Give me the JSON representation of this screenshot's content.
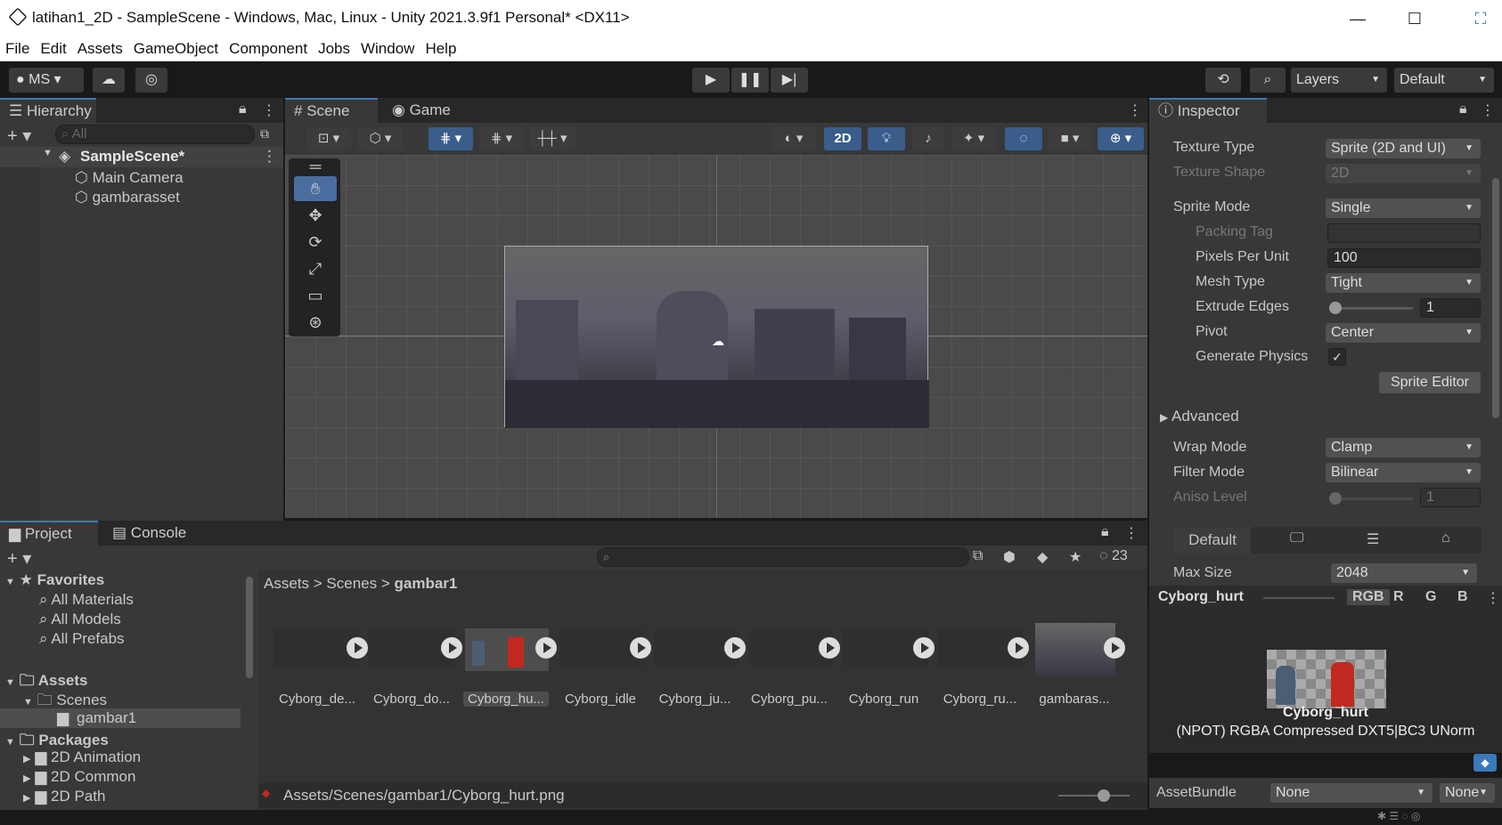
{
  "window": {
    "title": "latihan1_2D - SampleScene - Windows, Mac, Linux - Unity 2021.3.9f1 Personal* <DX11>",
    "minimize": "—",
    "maximize": "☐"
  },
  "menu": [
    "File",
    "Edit",
    "Assets",
    "GameObject",
    "Component",
    "Jobs",
    "Window",
    "Help"
  ],
  "toolbar": {
    "account": "MS",
    "layers": "Layers",
    "layout": "Default"
  },
  "hierarchy": {
    "tab": "Hierarchy",
    "search_placeholder": "All",
    "scene": "SampleScene*",
    "items": [
      "Main Camera",
      "gambarasset"
    ]
  },
  "scene_view": {
    "tabs": [
      "Scene",
      "Game"
    ],
    "mode_2d": "2D"
  },
  "inspector": {
    "tab": "Inspector",
    "rows": [
      {
        "label": "Texture Type",
        "value": "Sprite (2D and UI)"
      },
      {
        "label": "Texture Shape",
        "value": "2D"
      },
      {
        "label": "Sprite Mode",
        "value": "Single"
      },
      {
        "label": "Packing Tag",
        "value": ""
      },
      {
        "label": "Pixels Per Unit",
        "value": "100"
      },
      {
        "label": "Mesh Type",
        "value": "Tight"
      },
      {
        "label": "Extrude Edges",
        "value": "1"
      },
      {
        "label": "Pivot",
        "value": "Center"
      },
      {
        "label": "Generate Physics",
        "value": "✓"
      }
    ],
    "sprite_editor": "Sprite Editor",
    "advanced": "Advanced",
    "wrap_mode": {
      "label": "Wrap Mode",
      "value": "Clamp"
    },
    "filter_mode": {
      "label": "Filter Mode",
      "value": "Bilinear"
    },
    "aniso_level": {
      "label": "Aniso Level",
      "value": "1"
    },
    "platform_default": "Default",
    "max_size": {
      "label": "Max Size",
      "value": "2048"
    },
    "preview": {
      "name": "Cyborg_hurt",
      "channels": [
        "RGB",
        "R",
        "G",
        "B"
      ],
      "caption": "Cyborg_hurt",
      "info": "(NPOT)  RGBA Compressed DXT5|BC3 UNorm"
    },
    "assetbundle": {
      "label": "AssetBundle",
      "value": "None",
      "variant": "None"
    }
  },
  "project": {
    "tabs": [
      "Project",
      "Console"
    ],
    "hidden_count": "23",
    "favorites": {
      "title": "Favorites",
      "items": [
        "All Materials",
        "All Models",
        "All Prefabs"
      ]
    },
    "assets": {
      "title": "Assets",
      "scenes": "Scenes",
      "gambar1": "gambar1"
    },
    "packages": {
      "title": "Packages",
      "items": [
        "2D Animation",
        "2D Common",
        "2D Path"
      ]
    },
    "breadcrumb": [
      "Assets",
      "Scenes",
      "gambar1"
    ],
    "files": [
      "Cyborg_de...",
      "Cyborg_do...",
      "Cyborg_hu...",
      "Cyborg_idle",
      "Cyborg_ju...",
      "Cyborg_pu...",
      "Cyborg_run",
      "Cyborg_ru...",
      "gambaras..."
    ],
    "path": "Assets/Scenes/gambar1/Cyborg_hurt.png"
  },
  "colors": {
    "accent": "#3a79bb",
    "panel": "#383838",
    "selected": "#4d4d4d"
  }
}
